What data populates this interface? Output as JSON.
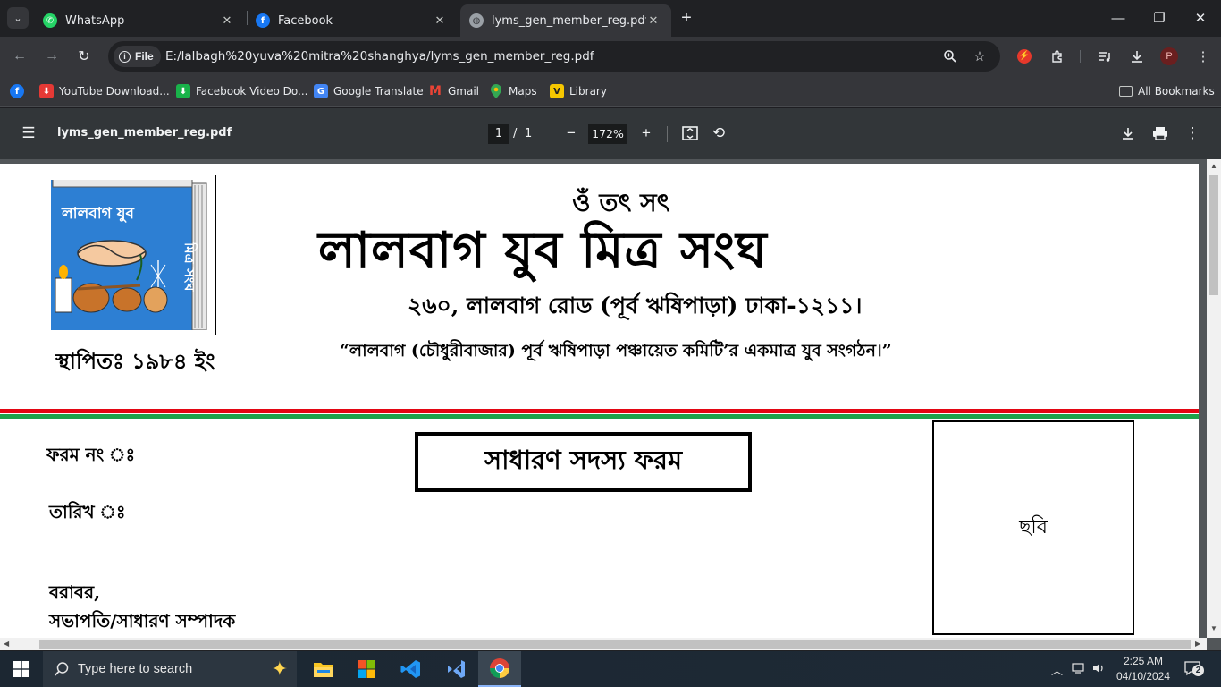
{
  "browser": {
    "tabs": [
      {
        "title": "WhatsApp",
        "icon": "whatsapp-icon",
        "active": false
      },
      {
        "title": "Facebook",
        "icon": "facebook-icon",
        "active": false
      },
      {
        "title": "lyms_gen_member_reg.pdf",
        "icon": "globe-icon",
        "active": true
      }
    ],
    "address": {
      "chip_label": "File",
      "url": "E:/lalbagh%20yuva%20mitra%20shanghya/lyms_gen_member_reg.pdf"
    },
    "profile_initial": "P",
    "bookmarks": [
      {
        "label": "",
        "icon": "facebook-icon"
      },
      {
        "label": "YouTube Download...",
        "icon": "download-red-icon"
      },
      {
        "label": "Facebook Video Do...",
        "icon": "download-green-icon"
      },
      {
        "label": "Google Translate",
        "icon": "translate-icon"
      },
      {
        "label": "Gmail",
        "icon": "gmail-icon"
      },
      {
        "label": "Maps",
        "icon": "maps-icon"
      },
      {
        "label": "Library",
        "icon": "library-icon"
      }
    ],
    "all_bookmarks": "All Bookmarks"
  },
  "pdf_viewer": {
    "file_name": "lyms_gen_member_reg.pdf",
    "current_page": "1",
    "page_separator": "/",
    "total_pages": "1",
    "zoom": "172%"
  },
  "document": {
    "invocation": "ওঁ তৎ সৎ",
    "org_name": "লালবাগ যুব মিত্র সংঘ",
    "address": "২৬০, লালবাগ রোড (পূর্ব ঋষিপাড়া) ঢাকা-১২১১।",
    "tagline": "“লালবাগ (চৌধুরীবাজার) পূর্ব ঋষিপাড়া পঞ্চায়েত কমিটি’র  একমাত্র যুব সংগঠন।”",
    "established": "স্থাপিতঃ ১৯৮৪ ইং",
    "logo_text": "লালবাগ যুব মিত্র সংঘ",
    "form_title": "সাধারণ সদস্য ফরম",
    "form_no_label": "ফরম নং ঃ",
    "date_label": "তারিখ ঃ",
    "photo_label": "ছবি",
    "addressee_1": "বরাবর,",
    "addressee_2": "সভাপতি/সাধারণ সম্পাদক",
    "colors": {
      "red_stripe": "#e30613",
      "green_stripe": "#1ea24a",
      "logo_blue": "#2d7fd3"
    }
  },
  "taskbar": {
    "search_placeholder": "Type here to search",
    "time": "2:25 AM",
    "date": "04/10/2024",
    "notification_count": "2",
    "apps": [
      "file-explorer-icon",
      "microsoft-store-icon",
      "vscode-icon",
      "visual-studio-icon",
      "chrome-icon"
    ]
  }
}
